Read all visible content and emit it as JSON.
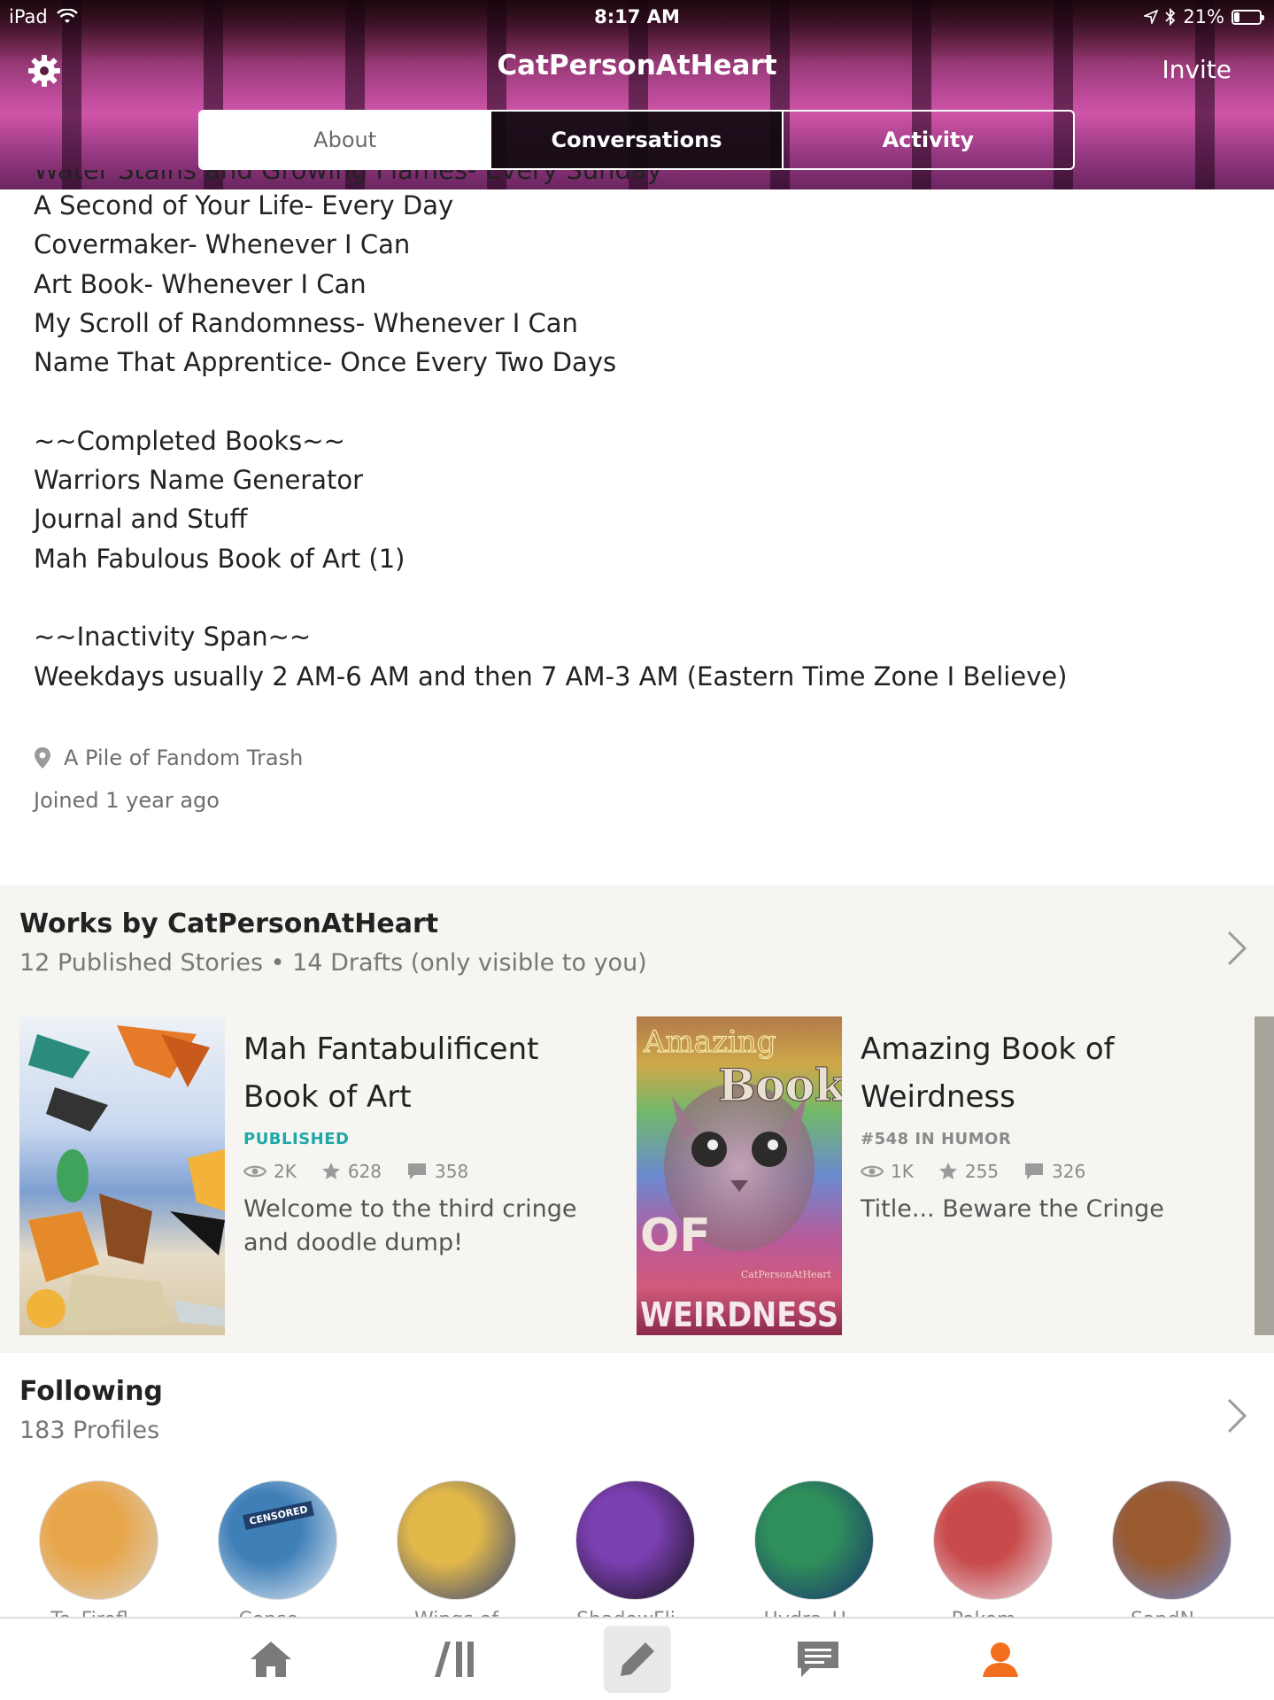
{
  "status_bar": {
    "carrier": "iPad",
    "time": "8:17 AM",
    "battery": "21%",
    "battery_level": 0.21
  },
  "header": {
    "title": "CatPersonAtHeart",
    "invite_label": "Invite"
  },
  "tabs": [
    {
      "label": "About",
      "active": true
    },
    {
      "label": "Conversations",
      "active": false
    },
    {
      "label": "Activity",
      "active": false
    }
  ],
  "about": {
    "cut_line": "Water Stains and Growing Flames- Every Sunday",
    "lines": [
      "A Second of Your Life- Every Day",
      "Covermaker- Whenever I Can",
      "Art Book- Whenever I Can",
      "My Scroll of Randomness- Whenever I Can",
      "Name That Apprentice- Once Every Two Days",
      "",
      "~~Completed Books~~",
      "Warriors Name Generator",
      "Journal and Stuff",
      "Mah Fabulous Book of Art (1)",
      "",
      "~~Inactivity Span~~",
      "Weekdays usually 2 AM-6 AM and then 7 AM-3 AM (Eastern Time Zone I Believe)"
    ],
    "location": "A Pile of Fandom Trash",
    "joined": "Joined 1 year ago"
  },
  "works": {
    "title": "Works by CatPersonAtHeart",
    "subtitle": "12 Published Stories • 14 Drafts (only visible to you)",
    "stories": [
      {
        "title": "Mah Fantabulificent Book of Art",
        "status": "PUBLISHED",
        "status_color": "#1fa8a8",
        "reads": "2K",
        "votes": "628",
        "comments": "358",
        "description": "Welcome to the third cringe and doodle dump!"
      },
      {
        "title": "Amazing Book of Weirdness",
        "status": "#548 IN HUMOR",
        "status_color": "#8a8a8a",
        "reads": "1K",
        "votes": "255",
        "comments": "326",
        "description": "Title... Beware the Cringe",
        "cover_text": {
          "top": "Amazing",
          "mid": "Book",
          "of": "OF",
          "bottom": "WEIRDNESS",
          "author": "CatPersonAtHeart"
        }
      }
    ]
  },
  "following": {
    "title": "Following",
    "subtitle": "183 Profiles",
    "avatars": [
      {
        "name": "Ta_Firefl...",
        "colors": [
          "#e8a64a",
          "#d9d2c8"
        ]
      },
      {
        "name": "Censo...",
        "colors": [
          "#3f7fb8",
          "#e8eef5"
        ],
        "badge": "CENSORED"
      },
      {
        "name": "Wings of Fir...",
        "colors": [
          "#e2b84a",
          "#2d3f7a"
        ]
      },
      {
        "name": "ShadowFli...",
        "colors": [
          "#7a3fb0",
          "#111"
        ]
      },
      {
        "name": "Hydra_H...",
        "colors": [
          "#2f8f5a",
          "#1a2f70"
        ]
      },
      {
        "name": "Pokem...",
        "colors": [
          "#c84a4a",
          "#e8e8f2"
        ]
      },
      {
        "name": "SandN...",
        "colors": [
          "#9a5a2f",
          "#6f8fe0"
        ]
      }
    ]
  },
  "nav": {
    "accent": "#f36f1f",
    "icon_color": "#7a7a7a"
  }
}
